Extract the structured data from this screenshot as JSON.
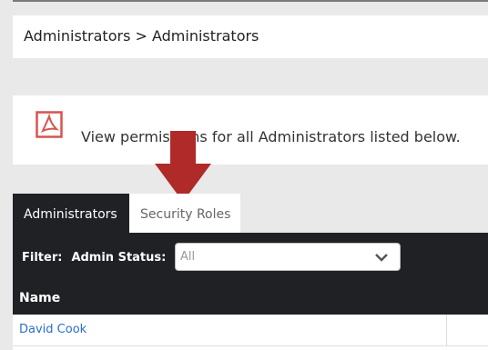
{
  "breadcrumb": "Administrators > Administrators",
  "info": {
    "text": "View permissions for all Administrators listed below.",
    "icon": "pdf-icon"
  },
  "tabs": [
    {
      "label": "Administrators",
      "active": true
    },
    {
      "label": "Security Roles",
      "active": false
    }
  ],
  "filter": {
    "label": "Filter:",
    "status_label": "Admin Status:",
    "selected": "All"
  },
  "table": {
    "columns": [
      "Name"
    ],
    "rows": [
      {
        "name": "David Cook"
      }
    ]
  },
  "colors": {
    "dark_panel": "#1f2125",
    "link": "#2a6fc9",
    "pdf_red": "#d9534f",
    "arrow_red": "#b02a2a"
  }
}
